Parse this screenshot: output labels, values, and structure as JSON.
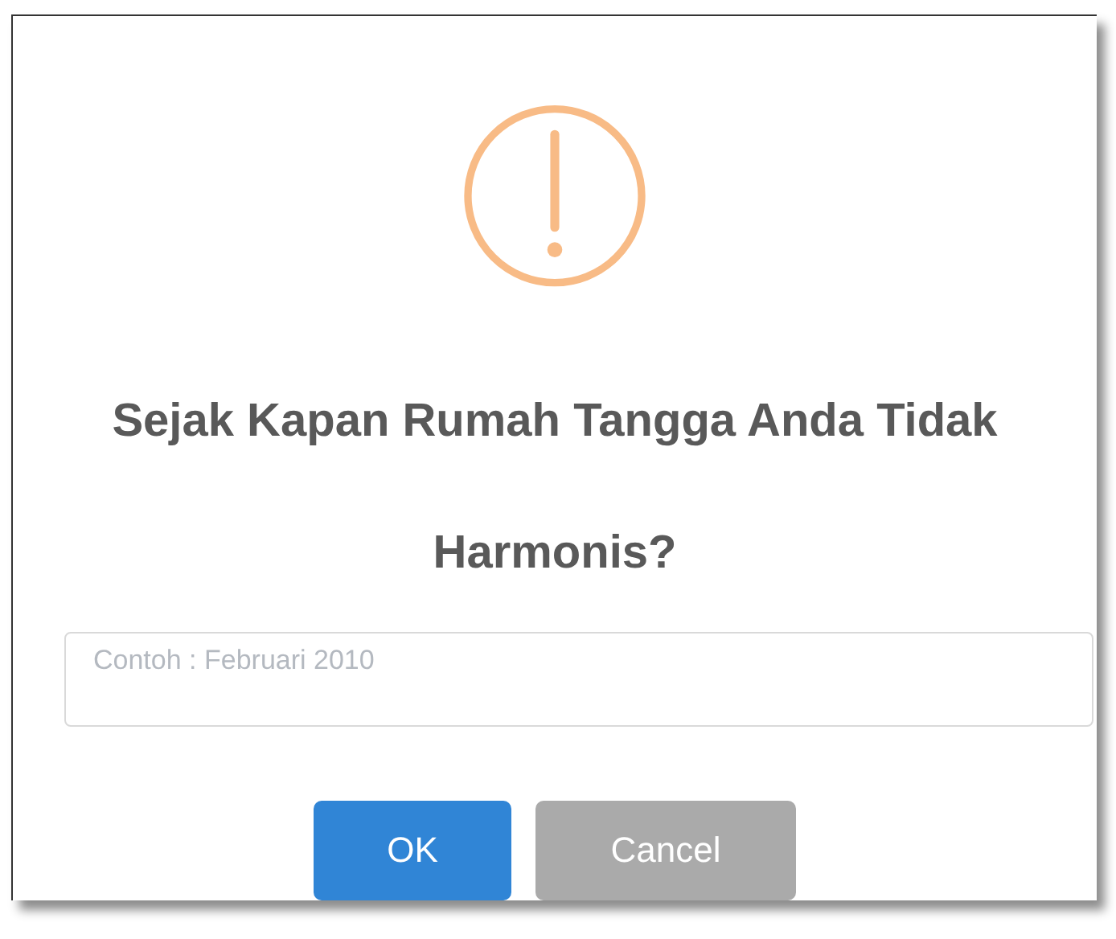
{
  "dialog": {
    "title": "Sejak Kapan Rumah Tangga Anda Tidak Harmonis?",
    "input": {
      "placeholder": "Contoh : Februari 2010"
    },
    "buttons": [
      {
        "label": "OK",
        "kind": "confirm"
      },
      {
        "label": "Cancel",
        "kind": "cancel"
      }
    ]
  }
}
